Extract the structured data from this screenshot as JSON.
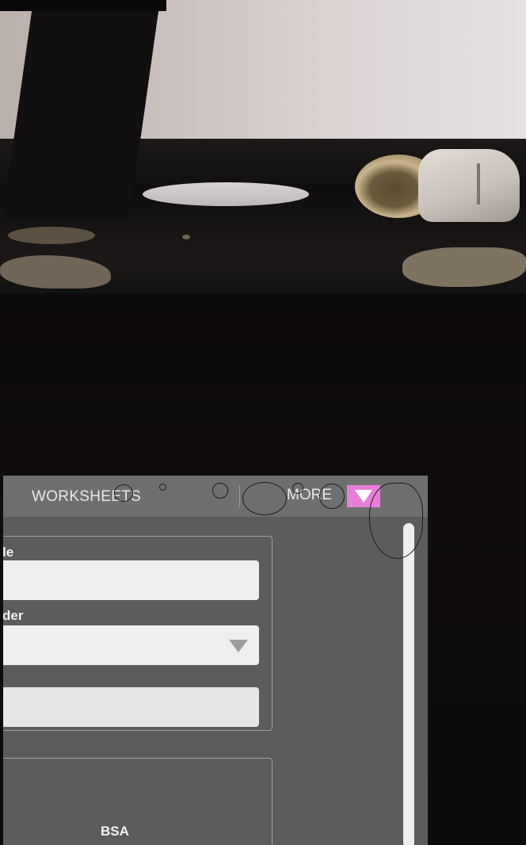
{
  "topbar": {
    "tab_worksheets": "WORKSHEETS",
    "tab_more": "MORE",
    "more_toggle_icon": "triangle-down-icon",
    "accent_color": "#e87fd6"
  },
  "form": {
    "title_label": "le",
    "gender_label": "der",
    "gender_dropdown_icon": "chevron-down-icon"
  },
  "bsa_panel": {
    "label": "BSA"
  }
}
